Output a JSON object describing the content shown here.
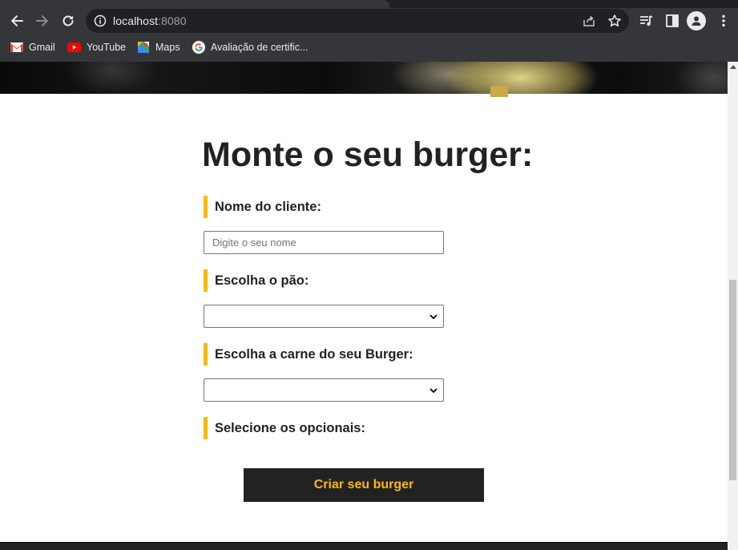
{
  "browser": {
    "url_host": "localhost",
    "url_port": ":8080",
    "bookmarks": [
      {
        "label": "Gmail",
        "icon": "gmail-icon"
      },
      {
        "label": "YouTube",
        "icon": "youtube-icon"
      },
      {
        "label": "Maps",
        "icon": "maps-icon"
      },
      {
        "label": "Avaliação de certific...",
        "icon": "google-icon"
      }
    ]
  },
  "page": {
    "title": "Monte o seu burger:",
    "form": {
      "name_label": "Nome do cliente:",
      "name_placeholder": "Digite o seu nome",
      "name_value": "",
      "bread_label": "Escolha o pão:",
      "bread_selected": "",
      "meat_label": "Escolha a carne do seu Burger:",
      "meat_selected": "",
      "optionals_label": "Selecione os opcionais:",
      "submit_label": "Criar seu burger"
    }
  },
  "colors": {
    "accent": "#fcba03",
    "dark": "#222222",
    "chrome": "#35363a",
    "omnibox": "#202124"
  }
}
